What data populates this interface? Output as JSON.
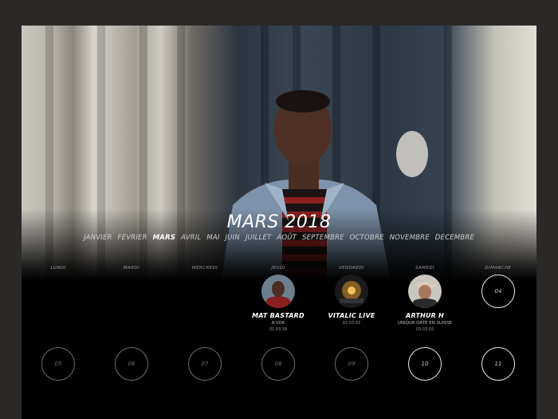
{
  "calendar": {
    "title": "MARS 2018",
    "months": [
      "JANVIER",
      "FEVRIER",
      "MARS",
      "AVRIL",
      "MAI",
      "JUIN",
      "JUILLET",
      "AOÛT",
      "SEPTEMBRE",
      "OCTOBRE",
      "NOVEMBRE",
      "DECEMBRE"
    ],
    "active_month": "MARS",
    "weekdays": [
      "LUNDI",
      "MARDI",
      "MERCREDI",
      "JEUDI",
      "VENDREDI",
      "SAMEDI",
      "DIMANCHE"
    ],
    "events": [
      {
        "name": "MAT BASTARD",
        "sub": "A-VOX",
        "date": "01.03.18",
        "icon": "artist-photo"
      },
      {
        "name": "VITALIC LIVE",
        "sub": "",
        "date": "02.03.02",
        "icon": "artist-photo"
      },
      {
        "name": "ARTHUR H",
        "sub": "UNIQUE DATE EN SUISSE",
        "date": "03.03.02",
        "icon": "artist-photo"
      }
    ],
    "row1_empty": [
      "04"
    ],
    "row2_days": [
      "05",
      "06",
      "07",
      "08",
      "09",
      "10",
      "11"
    ]
  },
  "colors": {
    "background": "#2a2927",
    "panel": "#000000",
    "text": "#ffffff"
  }
}
